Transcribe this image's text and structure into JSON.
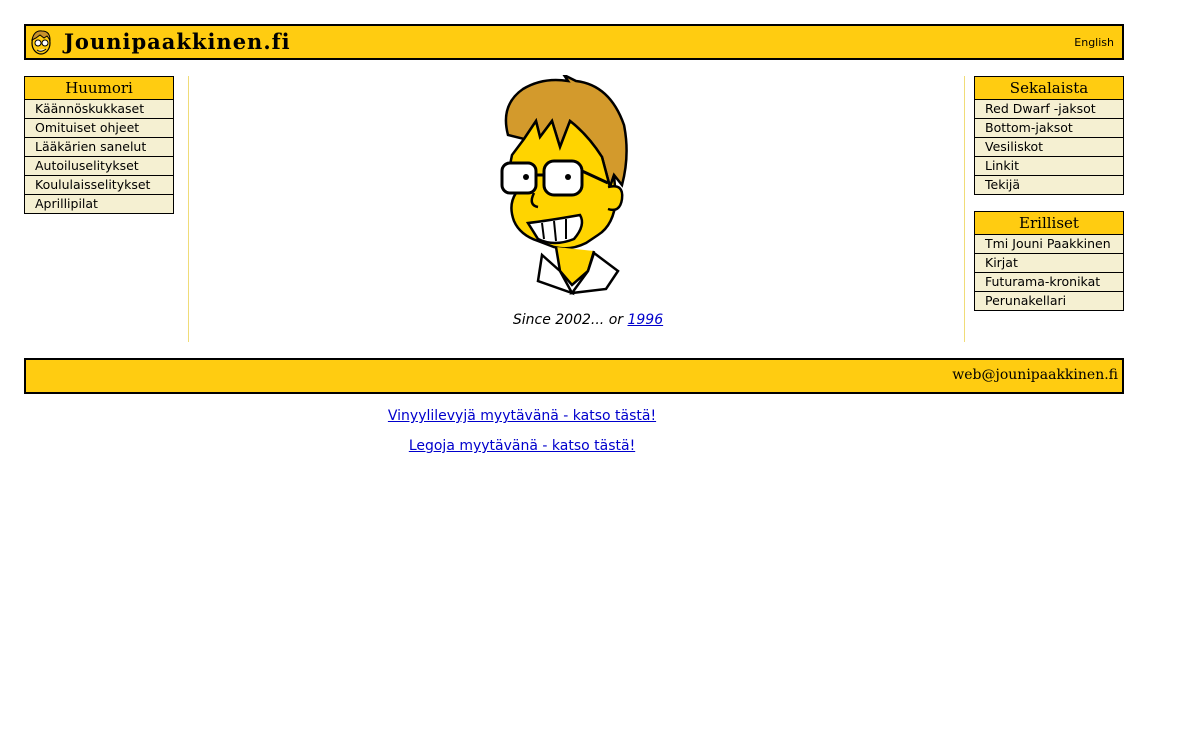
{
  "header": {
    "site_title": "Jounipaakkinen.fi",
    "language_link": "English"
  },
  "menu_left": {
    "title": "Huumori",
    "items": [
      "Käännöskukkaset",
      "Omituiset ohjeet",
      "Lääkärien sanelut",
      "Autoiluselitykset",
      "Koululaisselitykset",
      "Aprillipilat"
    ]
  },
  "menu_right_1": {
    "title": "Sekalaista",
    "items": [
      "Red Dwarf -jaksot",
      "Bottom-jaksot",
      "Vesiliskot",
      "Linkit",
      "Tekijä"
    ]
  },
  "menu_right_2": {
    "title": "Erilliset",
    "items": [
      "Tmi Jouni Paakkinen",
      "Kirjat",
      "Futurama-kronikat",
      "Perunakellari"
    ]
  },
  "center": {
    "since_prefix": "Since 2002... or",
    "since_link": "1996"
  },
  "footer": {
    "email": "web@jounipaakkinen.fi"
  },
  "sale_links": [
    "Vinyylilevyjä myytävänä - katso tästä!",
    "Legoja myytävänä - katso tästä!"
  ],
  "colors": {
    "bar": "#ffcc11",
    "menu_bg": "#f5f0d2",
    "link": "#0000cc"
  },
  "icons": [
    "cartoon-face-logo-icon",
    "cartoon-portrait-image"
  ]
}
